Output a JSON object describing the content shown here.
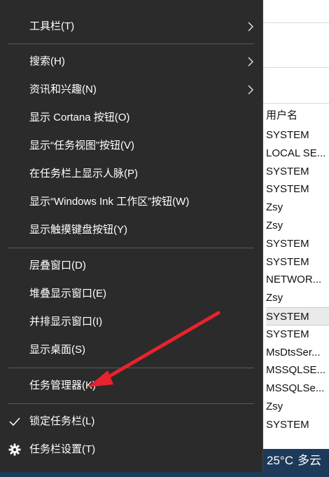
{
  "menu": {
    "items": [
      {
        "label": "工具栏(T)"
      },
      {
        "label": "搜索(H)"
      },
      {
        "label": "资讯和兴趣(N)"
      },
      {
        "label": "显示 Cortana 按钮(O)"
      },
      {
        "label": "显示“任务视图”按钮(V)"
      },
      {
        "label": "在任务栏上显示人脉(P)"
      },
      {
        "label": "显示“Windows Ink 工作区”按钮(W)"
      },
      {
        "label": "显示触摸键盘按钮(Y)"
      },
      {
        "label": "层叠窗口(D)"
      },
      {
        "label": "堆叠显示窗口(E)"
      },
      {
        "label": "并排显示窗口(I)"
      },
      {
        "label": "显示桌面(S)"
      },
      {
        "label": "任务管理器(K)"
      },
      {
        "label": "锁定任务栏(L)"
      },
      {
        "label": "任务栏设置(T)"
      }
    ]
  },
  "background": {
    "column_header": "用户名",
    "users": [
      "SYSTEM",
      "LOCAL SE...",
      "SYSTEM",
      "SYSTEM",
      "Zsy",
      "Zsy",
      "SYSTEM",
      "SYSTEM",
      "NETWOR...",
      "Zsy",
      "SYSTEM",
      "SYSTEM",
      "MsDtsSer...",
      "MSSQLSE...",
      "MSSQLSe...",
      "Zsy",
      "SYSTEM"
    ]
  },
  "taskbar": {
    "temperature": "25°C",
    "weather": "多云"
  },
  "colors": {
    "menu_bg": "#2b2b2b",
    "taskbar_bg": "#1e3a5a",
    "arrow": "#e8232b"
  },
  "icons": {
    "submenu": "chevron-right-icon",
    "checked": "checkmark-icon",
    "settings": "gear-icon"
  }
}
